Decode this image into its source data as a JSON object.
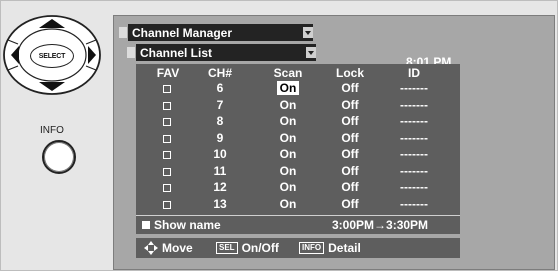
{
  "remote": {
    "select_label": "SELECT",
    "info_label": "INFO"
  },
  "menu": {
    "title": "Channel Manager",
    "submenu": "Channel List",
    "clock": "8:01 PM"
  },
  "table": {
    "headers": [
      "FAV",
      "CH#",
      "Scan",
      "Lock",
      "ID"
    ],
    "rows": [
      {
        "fav": false,
        "ch": "6",
        "scan": "On",
        "lock": "Off",
        "id": "-------",
        "selected": true
      },
      {
        "fav": false,
        "ch": "7",
        "scan": "On",
        "lock": "Off",
        "id": "-------",
        "selected": false
      },
      {
        "fav": false,
        "ch": "8",
        "scan": "On",
        "lock": "Off",
        "id": "-------",
        "selected": false
      },
      {
        "fav": false,
        "ch": "9",
        "scan": "On",
        "lock": "Off",
        "id": "-------",
        "selected": false
      },
      {
        "fav": false,
        "ch": "10",
        "scan": "On",
        "lock": "Off",
        "id": "-------",
        "selected": false
      },
      {
        "fav": false,
        "ch": "11",
        "scan": "On",
        "lock": "Off",
        "id": "-------",
        "selected": false
      },
      {
        "fav": false,
        "ch": "12",
        "scan": "On",
        "lock": "Off",
        "id": "-------",
        "selected": false
      },
      {
        "fav": false,
        "ch": "13",
        "scan": "On",
        "lock": "Off",
        "id": "-------",
        "selected": false
      }
    ]
  },
  "status": {
    "show_name": "Show name",
    "time_range": "3:00PM→3:30PM"
  },
  "footer": {
    "move_label": "Move",
    "sel_key": "SEL",
    "sel_label": "On/Off",
    "info_key": "INFO",
    "info_label": "Detail"
  },
  "icons": {
    "move": "four-way-arrow-icon",
    "favorite": "checkbox-icon"
  }
}
